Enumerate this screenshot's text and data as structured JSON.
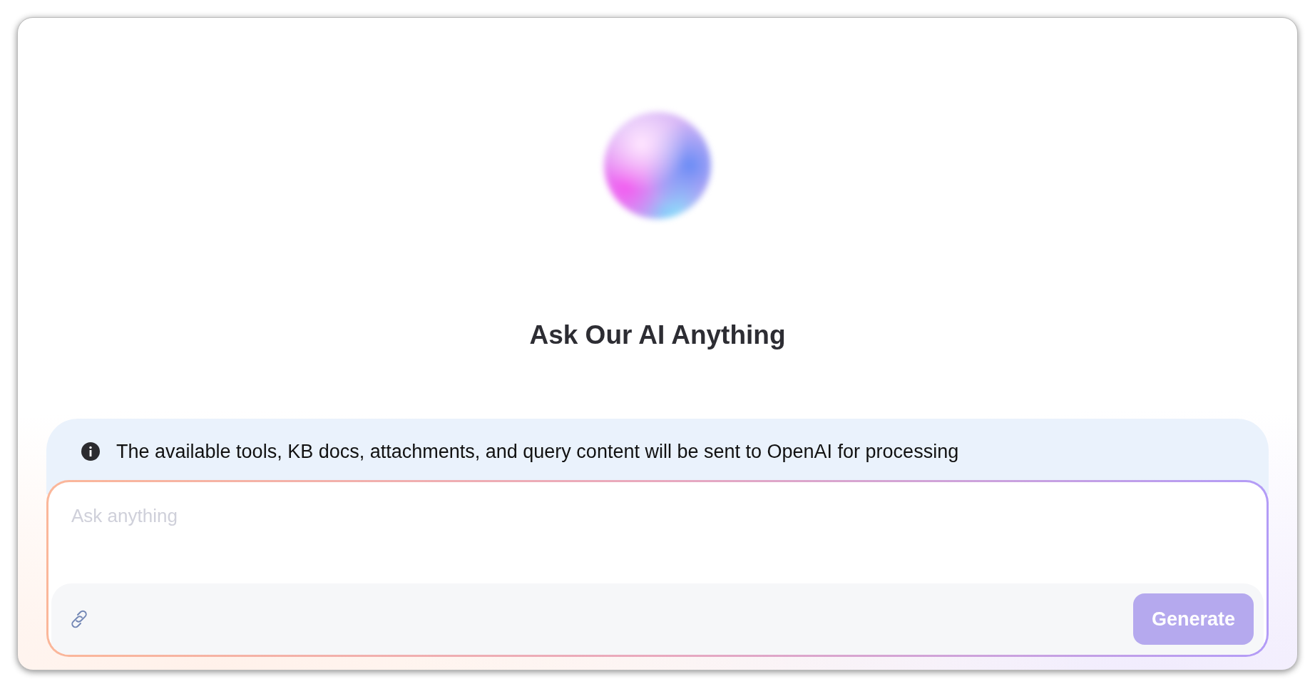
{
  "heading": "Ask Our AI Anything",
  "notice": {
    "text": "The available tools, KB docs, attachments, and query content will be sent to OpenAI for processing"
  },
  "composer": {
    "placeholder": "Ask anything",
    "generate_button": {
      "label": "Generate",
      "disabled": true
    }
  }
}
